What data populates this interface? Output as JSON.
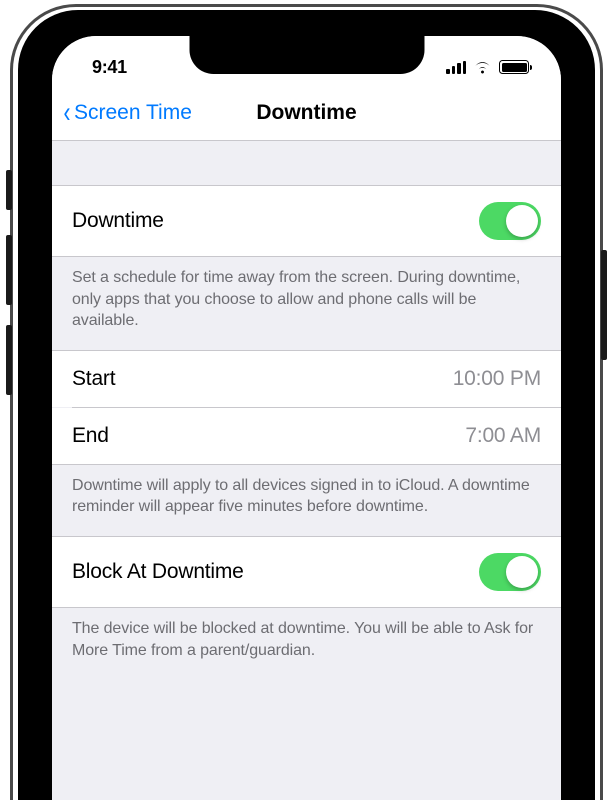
{
  "status": {
    "time": "9:41"
  },
  "nav": {
    "back_label": "Screen Time",
    "title": "Downtime"
  },
  "sections": {
    "downtime": {
      "label": "Downtime",
      "enabled": true,
      "footer": "Set a schedule for time away from the screen. During downtime, only apps that you choose to allow and phone calls will be available."
    },
    "schedule": {
      "start_label": "Start",
      "start_value": "10:00 PM",
      "end_label": "End",
      "end_value": "7:00 AM",
      "footer": "Downtime will apply to all devices signed in to iCloud. A downtime reminder will appear five minutes before downtime."
    },
    "block": {
      "label": "Block At Downtime",
      "enabled": true,
      "footer": "The device will be blocked at downtime. You will be able to Ask for More Time from a parent/guardian."
    }
  }
}
